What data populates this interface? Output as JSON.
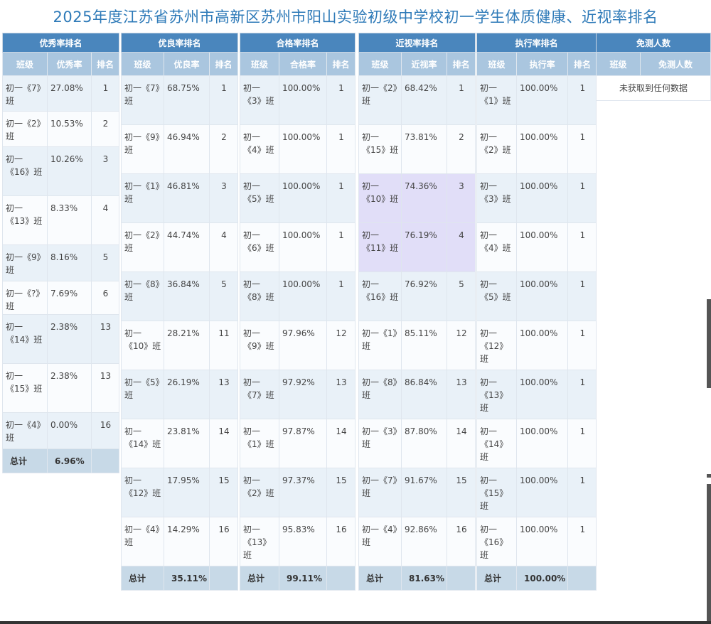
{
  "page_title": "2025年度江苏省苏州市高新区苏州市阳山实验初级中学校初一学生体质健康、近视率排名",
  "youxiu": {
    "caption": "优秀率排名",
    "headers": [
      "班级",
      "优秀率",
      "排名"
    ],
    "rows": [
      [
        "初一《7》班",
        "27.08%",
        "1"
      ],
      [
        "初一《2》班",
        "10.53%",
        "2"
      ],
      [
        "初一《16》班",
        "10.26%",
        "3"
      ],
      [
        "初一《13》班",
        "8.33%",
        "4"
      ],
      [
        "初一《9》班",
        "8.16%",
        "5"
      ],
      [
        "初一《?》班",
        "7.69%",
        "6"
      ],
      [
        "初一《14》班",
        "2.38%",
        "13"
      ],
      [
        "初一《15》班",
        "2.38%",
        "13"
      ],
      [
        "初一《4》班",
        "0.00%",
        "16"
      ]
    ],
    "total_label": "总计",
    "total_value": "6.96%"
  },
  "youliang": {
    "caption": "优良率排名",
    "headers": [
      "班级",
      "优良率",
      "排名"
    ],
    "rows": [
      [
        "初一《7》班",
        "68.75%",
        "1"
      ],
      [
        "初一《9》班",
        "46.94%",
        "2"
      ],
      [
        "初一《1》班",
        "46.81%",
        "3"
      ],
      [
        "初一《2》班",
        "44.74%",
        "4"
      ],
      [
        "初一《8》班",
        "36.84%",
        "5"
      ],
      [
        "初一《10》班",
        "28.21%",
        "11"
      ],
      [
        "初一《5》班",
        "26.19%",
        "13"
      ],
      [
        "初一《14》班",
        "23.81%",
        "14"
      ],
      [
        "初一《12》班",
        "17.95%",
        "15"
      ],
      [
        "初一《4》班",
        "14.29%",
        "16"
      ]
    ],
    "total_label": "总计",
    "total_value": "35.11%"
  },
  "hege": {
    "caption": "合格率排名",
    "headers": [
      "班级",
      "合格率",
      "排名"
    ],
    "rows": [
      [
        "初一《3》班",
        "100.00%",
        "1"
      ],
      [
        "初一《4》班",
        "100.00%",
        "1"
      ],
      [
        "初一《5》班",
        "100.00%",
        "1"
      ],
      [
        "初一《6》班",
        "100.00%",
        "1"
      ],
      [
        "初一《8》班",
        "100.00%",
        "1"
      ],
      [
        "初一《9》班",
        "97.96%",
        "12"
      ],
      [
        "初一《7》班",
        "97.92%",
        "13"
      ],
      [
        "初一《1》班",
        "97.87%",
        "14"
      ],
      [
        "初一《2》班",
        "97.37%",
        "15"
      ],
      [
        "初一《13》班",
        "95.83%",
        "16"
      ]
    ],
    "total_label": "总计",
    "total_value": "99.11%"
  },
  "jinshi": {
    "caption": "近视率排名",
    "headers": [
      "班级",
      "近视率",
      "排名"
    ],
    "rows": [
      [
        "初一《2》班",
        "68.42%",
        "1"
      ],
      [
        "初一《15》班",
        "73.81%",
        "2"
      ],
      [
        "初一《10》班",
        "74.36%",
        "3"
      ],
      [
        "初一《11》班",
        "76.19%",
        "4"
      ],
      [
        "初一《16》班",
        "76.92%",
        "5"
      ],
      [
        "初一《1》班",
        "85.11%",
        "12"
      ],
      [
        "初一《8》班",
        "86.84%",
        "13"
      ],
      [
        "初一《3》班",
        "87.80%",
        "14"
      ],
      [
        "初一《7》班",
        "91.67%",
        "15"
      ],
      [
        "初一《4》班",
        "92.86%",
        "16"
      ]
    ],
    "total_label": "总计",
    "total_value": "81.63%"
  },
  "zhixing": {
    "caption": "执行率排名",
    "headers": [
      "班级",
      "执行率",
      "排名"
    ],
    "rows": [
      [
        "初一《1》班",
        "100.00%",
        "1"
      ],
      [
        "初一《2》班",
        "100.00%",
        "1"
      ],
      [
        "初一《3》班",
        "100.00%",
        "1"
      ],
      [
        "初一《4》班",
        "100.00%",
        "1"
      ],
      [
        "初一《5》班",
        "100.00%",
        "1"
      ],
      [
        "初一《12》班",
        "100.00%",
        "1"
      ],
      [
        "初一《13》班",
        "100.00%",
        "1"
      ],
      [
        "初一《14》班",
        "100.00%",
        "1"
      ],
      [
        "初一《15》班",
        "100.00%",
        "1"
      ],
      [
        "初一《16》班",
        "100.00%",
        "1"
      ]
    ],
    "total_label": "总计",
    "total_value": "100.00%"
  },
  "mianche": {
    "caption": "免测人数",
    "headers": [
      "班级",
      "免测人数"
    ],
    "no_data": "未获取到任何数据"
  }
}
